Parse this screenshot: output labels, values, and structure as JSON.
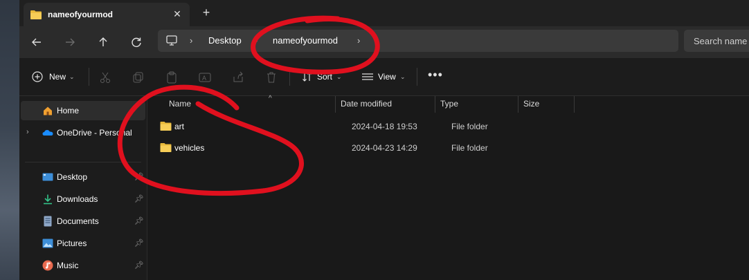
{
  "window": {
    "tab": {
      "title": "nameofyourmod",
      "close_icon": "close-icon"
    },
    "new_tab_icon": "plus-icon"
  },
  "address_bar": {
    "segments": [
      "Desktop",
      "nameofyourmod"
    ],
    "search_placeholder": "Search name"
  },
  "commands": {
    "new_label": "New",
    "sort_label": "Sort",
    "view_label": "View"
  },
  "sidebar": {
    "items": [
      {
        "label": "Home",
        "icon": "home-icon",
        "selected": true
      },
      {
        "label": "OneDrive - Personal",
        "icon": "onedrive-icon"
      },
      {
        "label": "Desktop",
        "icon": "desktop-icon",
        "pinned": true
      },
      {
        "label": "Downloads",
        "icon": "download-icon",
        "pinned": true
      },
      {
        "label": "Documents",
        "icon": "documents-icon",
        "pinned": true
      },
      {
        "label": "Pictures",
        "icon": "pictures-icon",
        "pinned": true
      },
      {
        "label": "Music",
        "icon": "music-icon",
        "pinned": true
      }
    ]
  },
  "files": {
    "columns": [
      "Name",
      "Date modified",
      "Type",
      "Size"
    ],
    "rows": [
      {
        "name": "art",
        "date": "2024-04-18 19:53",
        "type": "File folder",
        "size": ""
      },
      {
        "name": "vehicles",
        "date": "2024-04-23 14:29",
        "type": "File folder",
        "size": ""
      }
    ]
  },
  "colors": {
    "annotation": "#e0101e",
    "folder": "#f2c94c",
    "accent": "#4cc2ff"
  }
}
